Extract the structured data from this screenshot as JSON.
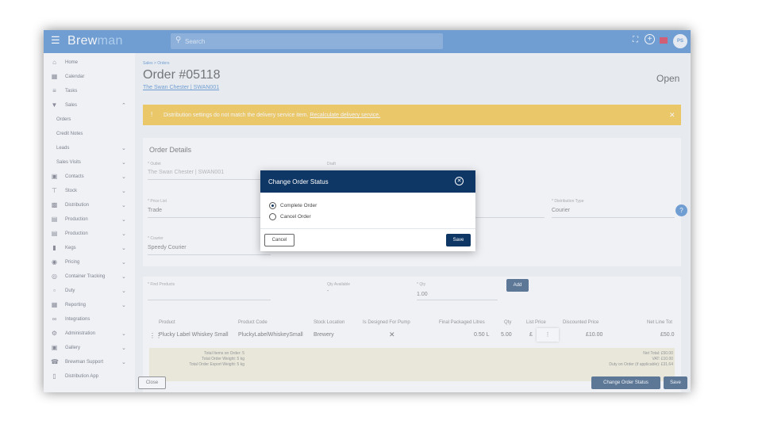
{
  "app": {
    "logo_main": "Brew",
    "logo_accent": "man",
    "avatar_initials": "PS"
  },
  "search": {
    "placeholder": "Search"
  },
  "sidebar": {
    "items": [
      {
        "label": "Home",
        "icon": "home-icon"
      },
      {
        "label": "Calendar",
        "icon": "calendar-icon"
      },
      {
        "label": "Tasks",
        "icon": "tasks-icon"
      },
      {
        "label": "Sales",
        "icon": "sales-icon"
      },
      {
        "label": "Orders"
      },
      {
        "label": "Credit Notes"
      },
      {
        "label": "Leads"
      },
      {
        "label": "Sales Visits"
      },
      {
        "label": "Contacts",
        "icon": "contacts-icon"
      },
      {
        "label": "Stock",
        "icon": "stock-icon"
      },
      {
        "label": "Distribution",
        "icon": "truck-icon"
      },
      {
        "label": "Production",
        "icon": "production-icon"
      },
      {
        "label": "Production",
        "icon": "production-icon"
      },
      {
        "label": "Kegs",
        "icon": "keg-icon"
      },
      {
        "label": "Pricing",
        "icon": "pricing-icon"
      },
      {
        "label": "Container Tracking",
        "icon": "container-icon"
      },
      {
        "label": "Duty",
        "icon": "duty-icon"
      },
      {
        "label": "Reporting",
        "icon": "reporting-icon"
      },
      {
        "label": "Integrations",
        "icon": "integrations-icon"
      },
      {
        "label": "Administration",
        "icon": "gear-icon"
      },
      {
        "label": "Gallery",
        "icon": "gallery-icon"
      },
      {
        "label": "Brewman Support",
        "icon": "support-icon"
      },
      {
        "label": "Distribution App",
        "icon": "phone-icon"
      }
    ]
  },
  "page": {
    "breadcrumb": "Sales > Orders",
    "title": "Order #05118",
    "customer_link": "The Swan Chester | SWAN001",
    "status": "Open"
  },
  "warning": {
    "text": "Distribution settings do not match the delivery service item.",
    "link": "Recalculate delivery service."
  },
  "details": {
    "heading": "Order Details",
    "outlet_label": "* Outlet",
    "outlet_value": "The Swan Chester | SWAN001",
    "draft_label": "Draft",
    "price_list_label": "* Price List",
    "price_list_value": "Trade",
    "distribution_type_label": "* Distribution Type",
    "distribution_type_value": "Courier",
    "courier_label": "* Courier",
    "courier_value": "Speedy Courier"
  },
  "products": {
    "find_label": "* Find Products",
    "qty_available_label": "Qty Available",
    "qty_available_value": "-",
    "qty_label": "* Qty",
    "qty_value": "1.00",
    "add_button": "Add",
    "columns": [
      "Product",
      "Product Code",
      "Stock Location",
      "Is Designed For Pump",
      "Final Packaged Litres",
      "Qty",
      "List Price",
      "Discounted Price",
      "Net Line Tot"
    ],
    "row": {
      "product": "Plucky Label Whiskey Small",
      "code": "PluckyLabelWhiskeySmall",
      "location": "Brewery",
      "pump": "✕",
      "litres": "0.50 L",
      "qty": "5.00",
      "list_price": "£",
      "discounted": "£10.00",
      "net": "£50.0"
    },
    "summary": {
      "total_items": "Total Items on Order: 5",
      "total_weight": "Total Order Weight: 5 kg",
      "export_weight": "Total Order Export Weight: 5 kg",
      "net_total": "Net Total: £50.00",
      "vat": "VAT: £10.00",
      "duty": "Duty on Order (if applicable): £31.64"
    }
  },
  "footer": {
    "close": "Close",
    "change_status": "Change Order Status",
    "save": "Save"
  },
  "modal": {
    "title": "Change Order Status",
    "options": [
      "Complete Order",
      "Cancel Order"
    ],
    "cancel": "Cancel",
    "save": "Save"
  }
}
